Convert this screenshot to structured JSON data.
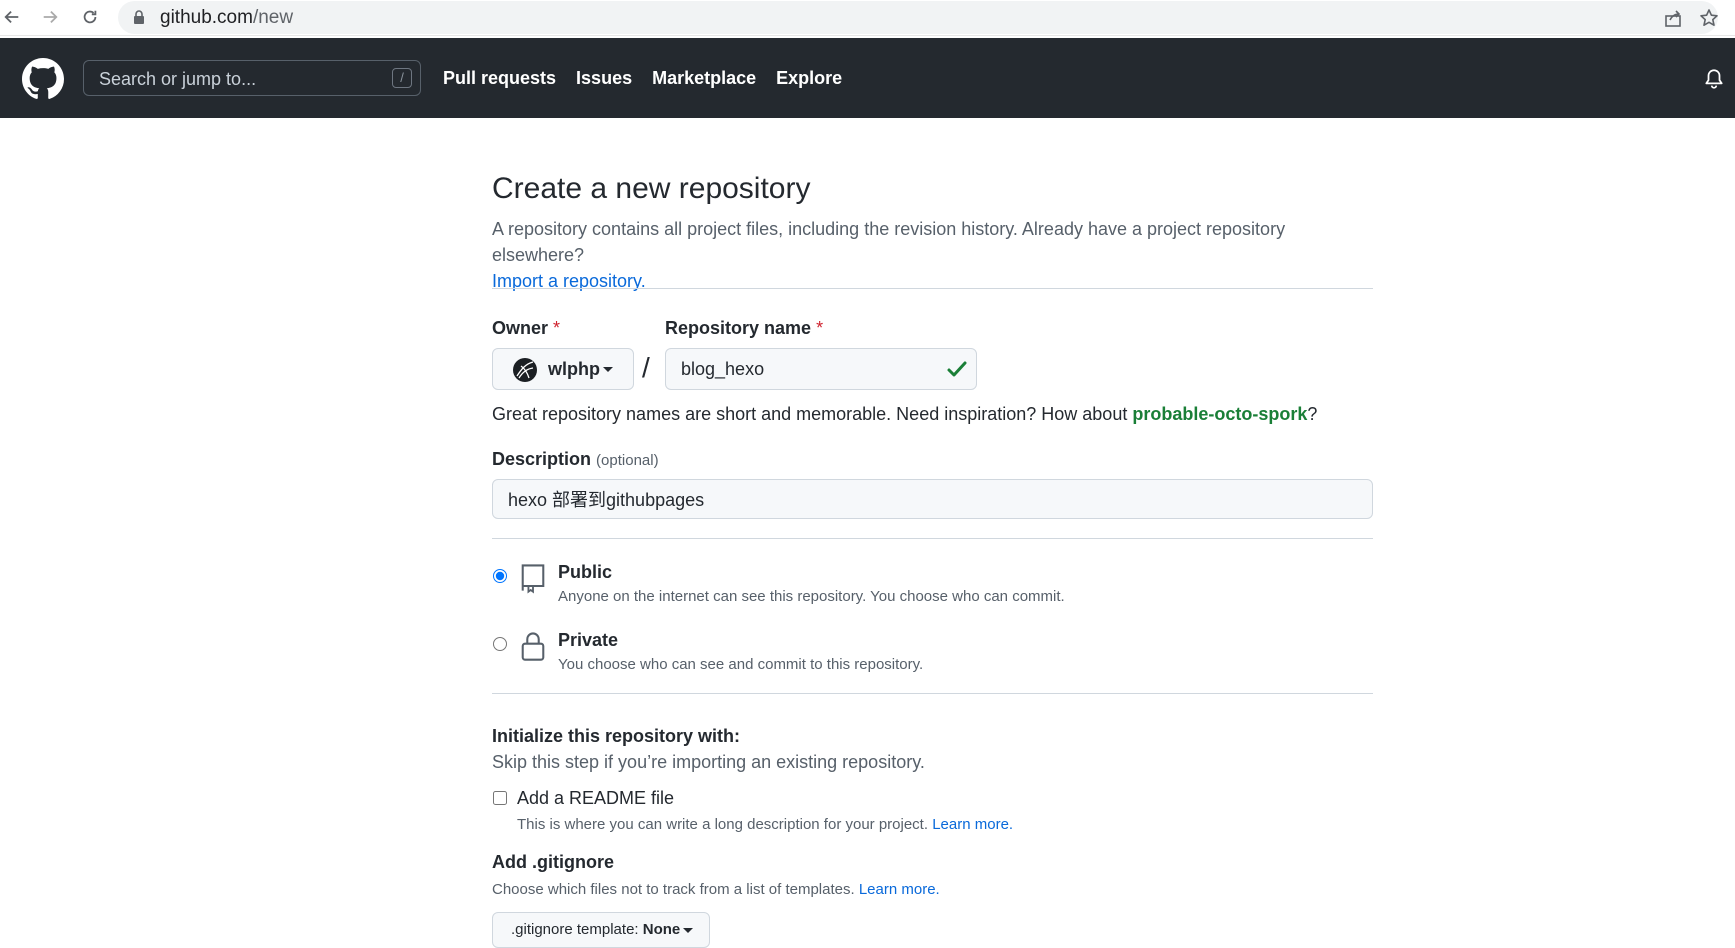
{
  "browser": {
    "url_host": "github.com",
    "url_path": "/new"
  },
  "header": {
    "search_placeholder": "Search or jump to...",
    "search_shortcut": "/",
    "nav": [
      "Pull requests",
      "Issues",
      "Marketplace",
      "Explore"
    ]
  },
  "page": {
    "title": "Create a new repository",
    "subtitle": "A repository contains all project files, including the revision history. Already have a project repository elsewhere?",
    "import_link": "Import a repository."
  },
  "form": {
    "owner_label": "Owner",
    "repo_label": "Repository name",
    "required_mark": "*",
    "owner_value": "wlphp",
    "separator": "/",
    "repo_value": "blog_hexo",
    "hint_prefix": "Great repository names are short and memorable. Need inspiration? How about",
    "hint_suggestion": "probable-octo-spork",
    "hint_suffix": "?",
    "description_label": "Description",
    "description_optional": "(optional)",
    "description_value": "hexo 部署到githubpages"
  },
  "visibility": {
    "public_title": "Public",
    "public_desc": "Anyone on the internet can see this repository. You choose who can commit.",
    "private_title": "Private",
    "private_desc": "You choose who can see and commit to this repository.",
    "selected": "public"
  },
  "initialize": {
    "title": "Initialize this repository with:",
    "subtitle": "Skip this step if you’re importing an existing repository.",
    "readme_label": "Add a README file",
    "readme_desc": "This is where you can write a long description for your project.",
    "learn_more": "Learn more.",
    "gitignore_title": "Add .gitignore",
    "gitignore_desc": "Choose which files not to track from a list of templates.",
    "gitignore_prefix": ".gitignore template:",
    "gitignore_value": "None"
  },
  "colors": {
    "header_bg": "#24292f",
    "link": "#0969da",
    "success": "#1a7f37",
    "required": "#cf222e"
  }
}
